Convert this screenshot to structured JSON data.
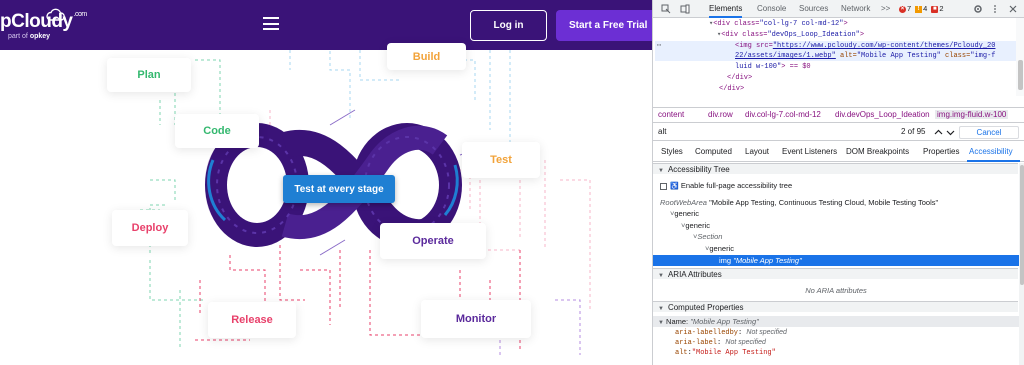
{
  "site": {
    "logo_text": "pCloudy",
    "logo_com": ".com",
    "logo_sub_prefix": "part of",
    "logo_sub_brand": "opkey",
    "login_label": "Log in",
    "trial_label": "Start a Free Trial",
    "diagram": {
      "center_label": "Test at every stage",
      "stages": {
        "build": "Build",
        "plan": "Plan",
        "code": "Code",
        "test": "Test",
        "deploy": "Deploy",
        "operate": "Operate",
        "release": "Release",
        "monitor": "Monitor"
      },
      "colors": {
        "plan": "#34b86f",
        "code": "#34b86f",
        "build": "#f2a33a",
        "test": "#f2a33a",
        "deploy": "#e8416b",
        "release": "#e8416b",
        "operate": "#5b2a9c",
        "monitor": "#5b2a9c",
        "loop": "#3a1378",
        "center": "#1f7fd3"
      }
    }
  },
  "devtools": {
    "tabs": [
      "Elements",
      "Console",
      "Sources",
      "Network"
    ],
    "more_tabs": ">>",
    "errors": "7",
    "warnings": "4",
    "issues": "2",
    "dom": {
      "line1_tag": "<div class=",
      "line1_class": "\"col-lg-7 col-md-12\"",
      "line1_end": ">",
      "line2_tag": "<div class=",
      "line2_class": "\"devOps_Loop_Ideation\"",
      "line2_end": ">",
      "img_open": "<img src=",
      "img_src_1": "\"https://www.pcloudy.com/wp-content/themes/Pcloudy_20",
      "img_src_2": "22/assets/images/1.webp\"",
      "img_alt_attr": " alt=",
      "img_alt_val": "\"Mobile App Testing\"",
      "img_class_attr": " class=",
      "img_class_val_1": "\"img-f",
      "img_class_val_2": "luid w-100\"",
      "img_end": "> == $0",
      "close1": "</div>",
      "close2": "</div>"
    },
    "breadcrumbs": [
      "content",
      "div.row",
      "div.col-lg-7.col-md-12",
      "div.devOps_Loop_Ideation",
      "img.img-fluid.w-100"
    ],
    "search": {
      "value": "alt",
      "count": "2 of 95",
      "cancel_label": "Cancel"
    },
    "subtabs": [
      "Styles",
      "Computed",
      "Layout",
      "Event Listeners",
      "DOM Breakpoints",
      "Properties",
      "Accessibility"
    ],
    "accessibility": {
      "tree_header": "Accessibility Tree",
      "enable_label": "Enable full-page accessibility tree",
      "root_role": "RootWebArea",
      "root_name": "\"Mobile App Testing, Continuous Testing Cloud, Mobile Testing Tools\"",
      "generic1": "generic",
      "generic2": "generic",
      "section": "Section",
      "generic3": "generic",
      "img_role": "img",
      "img_name": "\"Mobile App Testing\"",
      "aria_header": "ARIA Attributes",
      "no_aria": "No ARIA attributes",
      "computed_header": "Computed Properties",
      "name_label": "Name: ",
      "name_value": "\"Mobile App Testing\"",
      "labelledby_key": "aria-labelledby",
      "labelledby_val": "Not specified",
      "label_key": "aria-label",
      "label_val": "Not specified",
      "alt_key": "alt",
      "alt_val": "\"Mobile App Testing\""
    }
  }
}
